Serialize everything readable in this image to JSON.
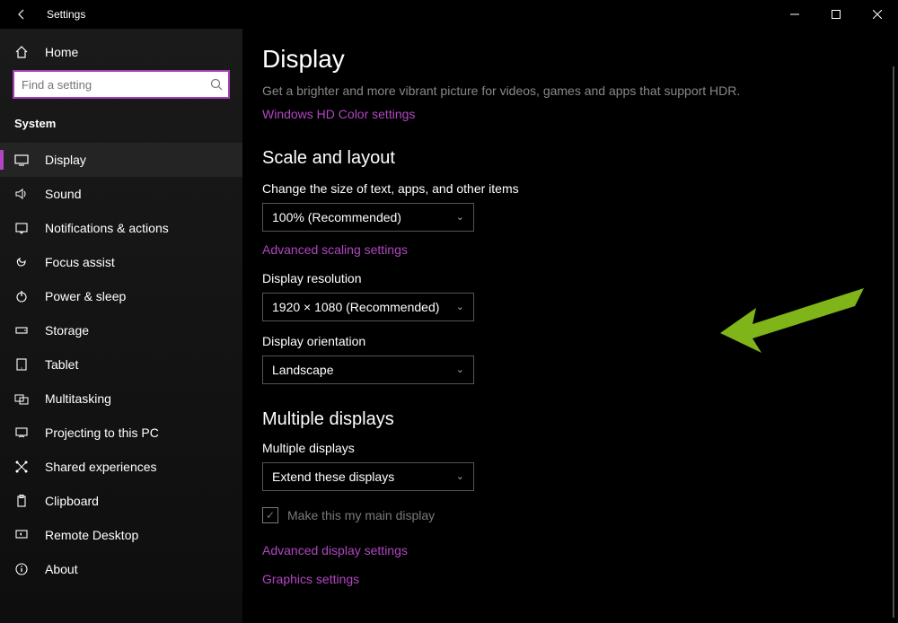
{
  "titlebar": {
    "title": "Settings"
  },
  "sidebar": {
    "home": "Home",
    "search_placeholder": "Find a setting",
    "section": "System",
    "items": [
      {
        "label": "Display"
      },
      {
        "label": "Sound"
      },
      {
        "label": "Notifications & actions"
      },
      {
        "label": "Focus assist"
      },
      {
        "label": "Power & sleep"
      },
      {
        "label": "Storage"
      },
      {
        "label": "Tablet"
      },
      {
        "label": "Multitasking"
      },
      {
        "label": "Projecting to this PC"
      },
      {
        "label": "Shared experiences"
      },
      {
        "label": "Clipboard"
      },
      {
        "label": "Remote Desktop"
      },
      {
        "label": "About"
      }
    ]
  },
  "content": {
    "page_title": "Display",
    "hdr_body": "Get a brighter and more vibrant picture for videos, games and apps that support HDR.",
    "hdr_link": "Windows HD Color settings",
    "scale": {
      "heading": "Scale and layout",
      "size_label": "Change the size of text, apps, and other items",
      "size_value": "100% (Recommended)",
      "advanced_scaling": "Advanced scaling settings",
      "resolution_label": "Display resolution",
      "resolution_value": "1920 × 1080 (Recommended)",
      "orientation_label": "Display orientation",
      "orientation_value": "Landscape"
    },
    "multi": {
      "heading": "Multiple displays",
      "label": "Multiple displays",
      "value": "Extend these displays",
      "main_check": "Make this my main display"
    },
    "adv_display": "Advanced display settings",
    "graphics": "Graphics settings"
  }
}
